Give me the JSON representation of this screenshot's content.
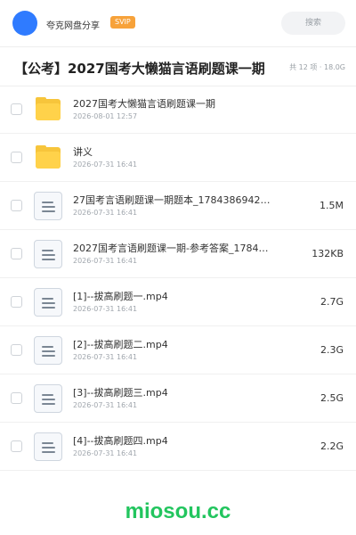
{
  "header": {
    "share_name": "夸克网盘分享",
    "badge": "SVIP",
    "search_placeholder": "搜索"
  },
  "folder": {
    "title": "【公考】2027国考大懒猫言语刷题课一期",
    "meta": "共 12 项 · 18.0G"
  },
  "files": [
    {
      "type": "folder",
      "icon": "folder-icon",
      "name": "2027国考大懒猫言语刷题课一期",
      "date": "2026-08-01 12:57",
      "size": ""
    },
    {
      "type": "folder",
      "icon": "folder-icon",
      "name": "讲义",
      "date": "2026-07-31 16:41",
      "size": ""
    },
    {
      "type": "file",
      "icon": "document-icon",
      "name": "27国考言语刷题课一期题本_17843869422…",
      "date": "2026-07-31 16:41",
      "size": "1.5M"
    },
    {
      "type": "file",
      "icon": "document-icon",
      "name": "2027国考言语刷题课一期-参考答案_178438…",
      "date": "2026-07-31 16:41",
      "size": "132KB"
    },
    {
      "type": "file",
      "icon": "document-icon",
      "name": "[1]--拔高刷题一.mp4",
      "date": "2026-07-31 16:41",
      "size": "2.7G"
    },
    {
      "type": "file",
      "icon": "document-icon",
      "name": "[2]--拔高刷题二.mp4",
      "date": "2026-07-31 16:41",
      "size": "2.3G"
    },
    {
      "type": "file",
      "icon": "document-icon",
      "name": "[3]--拔高刷题三.mp4",
      "date": "2026-07-31 16:41",
      "size": "2.5G"
    },
    {
      "type": "file",
      "icon": "document-icon",
      "name": "[4]--拔高刷题四.mp4",
      "date": "2026-07-31 16:41",
      "size": "2.2G"
    }
  ],
  "watermark": "miosou.cc",
  "colors": {
    "accent": "#2f7bff",
    "svip": "#f7a23a",
    "folder": "#ffd24a",
    "watermark": "#22c55e"
  }
}
